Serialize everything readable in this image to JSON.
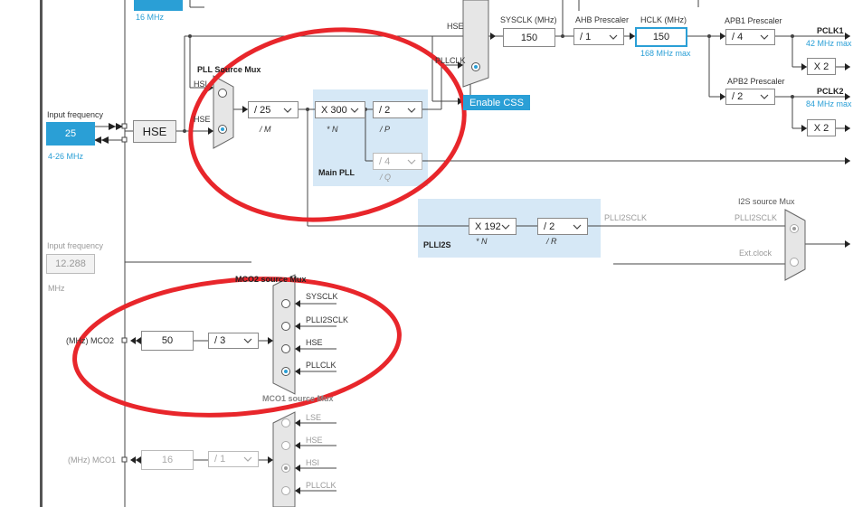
{
  "top": {
    "hsi_freq": "16 MHz"
  },
  "system": {
    "sysclk_label": "SYSCLK (MHz)",
    "sysclk_value": "150",
    "ahb_label": "AHB Prescaler",
    "ahb_value": "/ 1",
    "hclk_label": "HCLK (MHz)",
    "hclk_value": "150",
    "hclk_max": "168 MHz max",
    "hse_label": "HSE",
    "pllclk_label": "PLLCLK",
    "enable_css": "Enable CSS"
  },
  "apb1": {
    "label": "APB1 Prescaler",
    "value": "/ 4",
    "pclk_label": "PCLK1",
    "pclk_max": "42 MHz max",
    "x2": "X 2"
  },
  "apb2": {
    "label": "APB2 Prescaler",
    "value": "/ 2",
    "pclk_label": "PCLK2",
    "pclk_max": "84 MHz max",
    "x2": "X 2"
  },
  "input": {
    "label": "Input frequency",
    "value": "25",
    "range": "4-26 MHz",
    "hse_box": "HSE"
  },
  "pll_mux": {
    "title": "PLL Source Mux",
    "hsi": "HSI",
    "hse": "HSE"
  },
  "main_pll": {
    "title": "Main PLL",
    "m_value": "/ 25",
    "m_label": "/ M",
    "n_value": "X 300",
    "n_label": "* N",
    "p_value": "/ 2",
    "p_label": "/ P",
    "q_value": "/ 4",
    "q_label": "/ Q"
  },
  "plli2s": {
    "title": "PLLI2S",
    "clk_label": "PLLI2SCLK",
    "n_value": "X 192",
    "n_label": "* N",
    "r_value": "/ 2",
    "r_label": "/ R"
  },
  "i2s_mux": {
    "title": "I2S source Mux",
    "plli2sclk": "PLLI2SCLK",
    "ext_clock": "Ext.clock"
  },
  "input2": {
    "label": "Input frequency",
    "value": "12.288",
    "unit": "MHz"
  },
  "mco2": {
    "title": "MCO2 source Mux",
    "label": "(MHz) MCO2",
    "value": "50",
    "div": "/ 3",
    "options": [
      "SYSCLK",
      "PLLI2SCLK",
      "HSE",
      "PLLCLK"
    ]
  },
  "mco1": {
    "title": "MCO1 source Mux",
    "label": "(MHz) MCO1",
    "value": "16",
    "div": "/ 1",
    "options": [
      "LSE",
      "HSE",
      "HSI",
      "PLLCLK"
    ]
  },
  "colors": {
    "accent": "#2a9fd6",
    "region": "#d6e8f6",
    "annotation": "#e8262b"
  }
}
